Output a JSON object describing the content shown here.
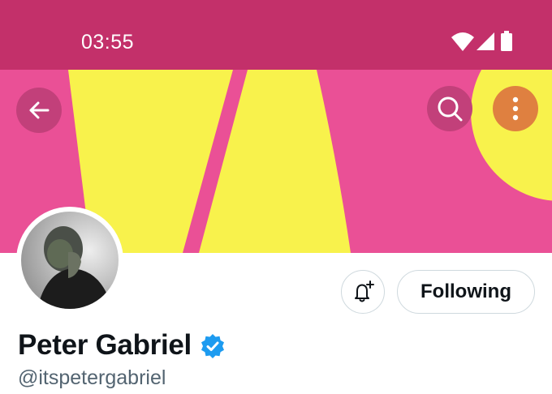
{
  "status_bar": {
    "time": "03:55",
    "background": "#c3306a",
    "icons": [
      "wifi-icon",
      "signal-icon",
      "battery-icon"
    ]
  },
  "header": {
    "banner_colors": {
      "pink": "#ea5096",
      "yellow": "#f8f24c"
    },
    "back_icon": "arrow-left-icon",
    "search_icon": "search-icon",
    "more_icon": "more-vertical-icon",
    "more_button_color": "#df8040"
  },
  "profile": {
    "display_name": "Peter Gabriel",
    "verified": true,
    "verified_color": "#1d9bf0",
    "handle": "@itspetergabriel",
    "notify_icon": "bell-plus-icon",
    "follow_button_label": "Following"
  }
}
